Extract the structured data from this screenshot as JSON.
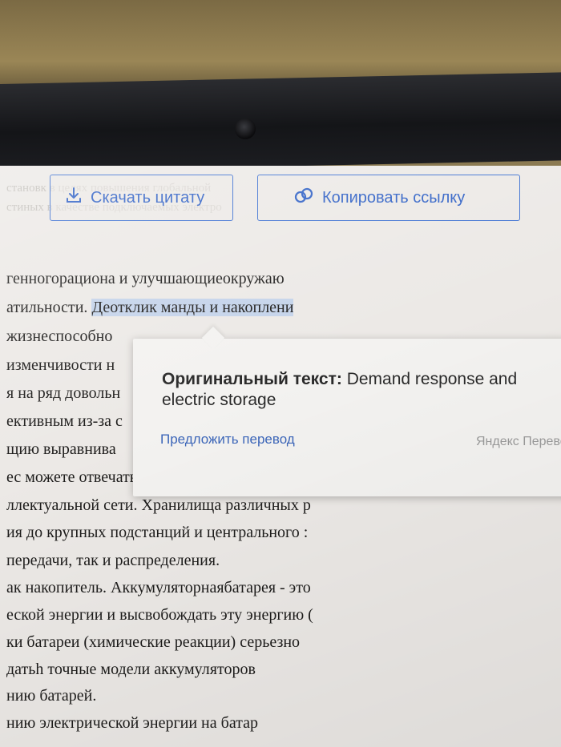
{
  "header": {
    "ghost_line1": "становк в целях повышения глобальной",
    "ghost_line2": "стиных в качестве подключаемых электро"
  },
  "toolbar": {
    "download_label": "Скачать цитату",
    "copy_link_label": "Копировать ссылку",
    "accent": "#2d5fc5"
  },
  "document": {
    "lines": [
      "генногорациона  и  улучшающиеокружаю",
      "атильности. ",
      "Деотклик манды и накоплени",
      "жизнеспособно",
      "изменчивости н",
      "я на ряд довольн",
      "ективным из-за с",
      "щию выравнива",
      "ес можете отвечать в миллисекундных врем",
      "ллектуальной сети. Хранилища различных р",
      "ия до крупных подстанций и центрального :",
      "передачи, так и распределения.",
      "ак накопитель. Аккумуляторнаябатарея - это",
      "еской энергии и высвобождать эту энергию (",
      "ки батареи (химические реакции) серьезно",
      "датьh точные модели аккумуляторов",
      "нию батарей.",
      "нию  электрической  энергии  на  батар"
    ]
  },
  "popup": {
    "original_label": "Оригинальный текст:",
    "original_text": " Demand response and electric storage",
    "suggest_label": "Предложить перевод",
    "brand": "Яндекс Переве"
  }
}
